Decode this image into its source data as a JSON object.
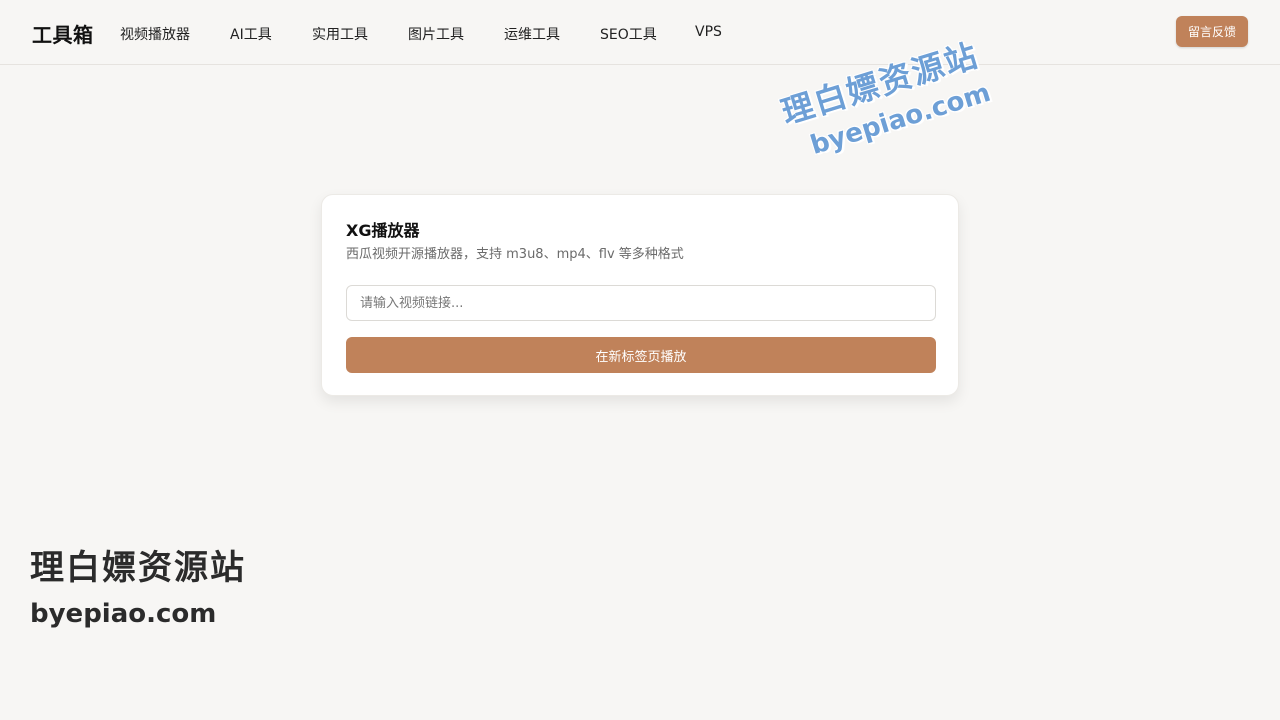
{
  "header": {
    "brand": "工具箱",
    "nav": [
      {
        "label": "视频播放器"
      },
      {
        "label": "AI工具"
      },
      {
        "label": "实用工具"
      },
      {
        "label": "图片工具"
      },
      {
        "label": "运维工具"
      },
      {
        "label": "SEO工具"
      },
      {
        "label": "VPS"
      }
    ],
    "feedback_label": "留言反馈"
  },
  "player": {
    "title": "XG播放器",
    "subtitle": "西瓜视频开源播放器，支持 m3u8、mp4、flv 等多种格式",
    "input_value": "",
    "input_placeholder": "请输入视频链接...",
    "play_label": "在新标签页播放"
  },
  "watermarks": {
    "top": {
      "cn": "理白嫖资源站",
      "en": "byepiao.com"
    },
    "bottom": {
      "cn": "理白嫖资源站",
      "en": "byepiao.com"
    }
  },
  "colors": {
    "accent": "#c0825a",
    "background": "#f7f6f4",
    "watermark_blue": "#6d9fd6"
  }
}
